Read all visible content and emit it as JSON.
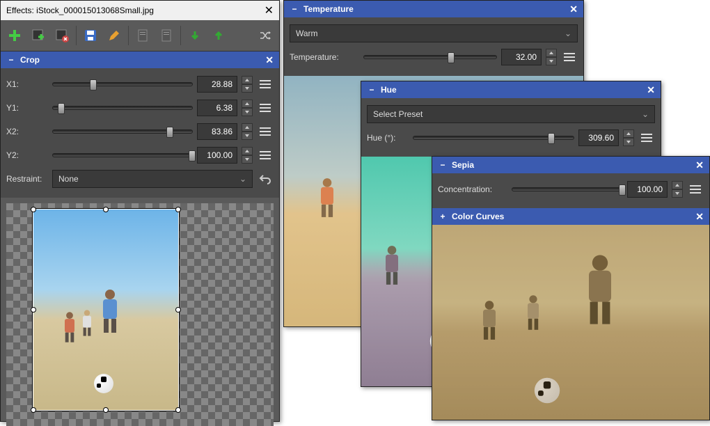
{
  "effects_window": {
    "title": "Effects: iStock_000015013068Small.jpg",
    "crop": {
      "title": "Crop",
      "x1_label": "X1:",
      "x1_value": "28.88",
      "y1_label": "Y1:",
      "y1_value": "6.38",
      "x2_label": "X2:",
      "x2_value": "83.86",
      "y2_label": "Y2:",
      "y2_value": "100.00",
      "restraint_label": "Restraint:",
      "restraint_value": "None"
    }
  },
  "temperature_panel": {
    "title": "Temperature",
    "preset": "Warm",
    "label": "Temperature:",
    "value": "32.00"
  },
  "hue_panel": {
    "title": "Hue",
    "preset": "Select Preset",
    "label": "Hue (°):",
    "value": "309.60"
  },
  "sepia_panel": {
    "title": "Sepia",
    "label": "Concentration:",
    "value": "100.00",
    "curves_title": "Color Curves"
  }
}
